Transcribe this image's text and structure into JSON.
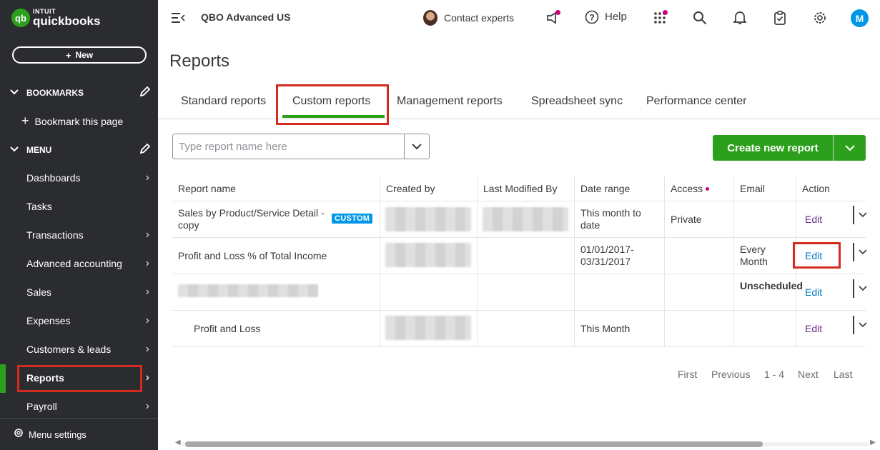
{
  "app": {
    "brand_top": "INTUIT",
    "brand_name": "quickbooks",
    "brand_mark": "qb",
    "company": "QBO Advanced US"
  },
  "sidebar": {
    "new_label": "New",
    "bookmarks_label": "BOOKMARKS",
    "bookmark_page_label": "Bookmark this page",
    "menu_label": "MENU",
    "items": [
      {
        "label": "Dashboards",
        "has_arrow": true
      },
      {
        "label": "Tasks",
        "has_arrow": false
      },
      {
        "label": "Transactions",
        "has_arrow": true
      },
      {
        "label": "Advanced accounting",
        "has_arrow": true
      },
      {
        "label": "Sales",
        "has_arrow": true
      },
      {
        "label": "Expenses",
        "has_arrow": true
      },
      {
        "label": "Customers & leads",
        "has_arrow": true
      },
      {
        "label": "Reports",
        "has_arrow": true,
        "active": true
      },
      {
        "label": "Payroll",
        "has_arrow": true
      }
    ],
    "menu_settings_label": "Menu settings"
  },
  "topbar": {
    "contact_experts": "Contact experts",
    "help": "Help",
    "avatar_initial": "M"
  },
  "page": {
    "title": "Reports"
  },
  "tabs": [
    {
      "label": "Standard reports"
    },
    {
      "label": "Custom reports",
      "active": true
    },
    {
      "label": "Management reports"
    },
    {
      "label": "Spreadsheet sync"
    },
    {
      "label": "Performance center"
    }
  ],
  "search": {
    "placeholder": "Type report name here",
    "value": ""
  },
  "create_button": {
    "label": "Create new report"
  },
  "table": {
    "headers": [
      "Report name",
      "Created by",
      "Last Modified By",
      "Date range",
      "Access",
      "Email",
      "Action"
    ],
    "rows": [
      {
        "name": "Sales by Product/Service Detail - copy",
        "badge": "CUSTOM",
        "created_by": "",
        "modified_by": "",
        "date_range": "This month to date",
        "access": "Private",
        "email": "",
        "action": "Edit"
      },
      {
        "name": "Profit and Loss % of Total Income",
        "badge": "",
        "created_by": "",
        "modified_by": "",
        "date_range": "01/01/2017-03/31/2017",
        "access": "",
        "email": "Every Month",
        "action": "Edit"
      },
      {
        "name": "",
        "badge": "",
        "created_by": "",
        "modified_by": "",
        "date_range": "",
        "access": "",
        "email": "Unscheduled",
        "action": "Edit"
      },
      {
        "name": "Profit and Loss",
        "badge": "",
        "created_by": "",
        "modified_by": "",
        "date_range": "This Month",
        "access": "",
        "email": "",
        "action": "Edit"
      }
    ]
  },
  "pagination": {
    "first": "First",
    "previous": "Previous",
    "range": "1 - 4",
    "next": "Next",
    "last": "Last"
  },
  "colors": {
    "brand_green": "#2ca01c",
    "sidebar_bg": "#2b2c2f",
    "highlight_red": "#d52b1e",
    "badge_blue": "#0097e6",
    "notification_pink": "#c9007a"
  }
}
